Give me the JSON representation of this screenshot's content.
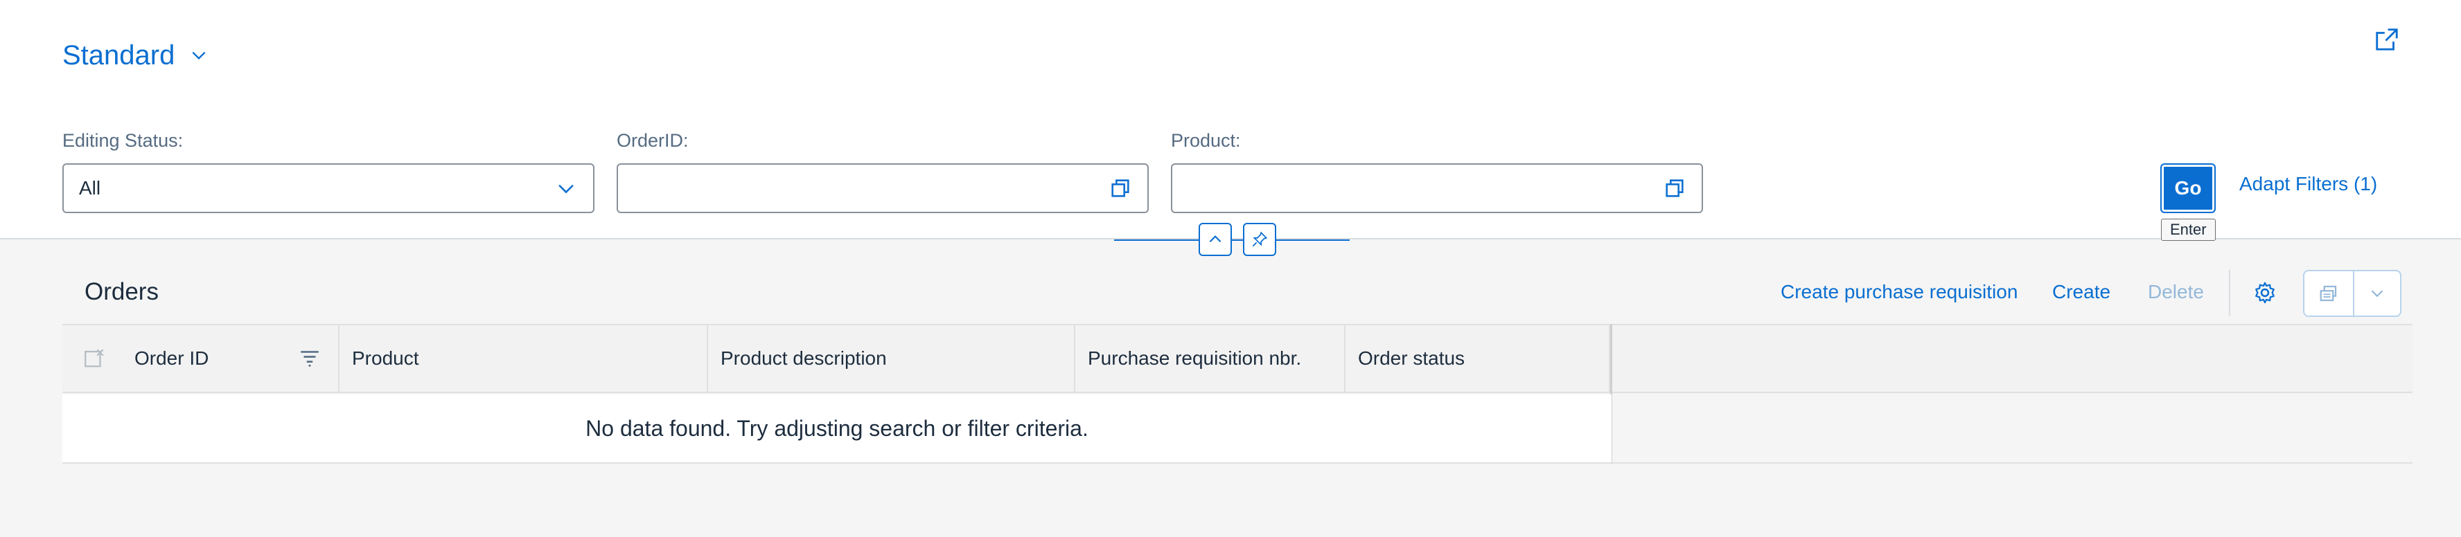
{
  "variant": {
    "title": "Standard"
  },
  "filters": {
    "editing_status": {
      "label": "Editing Status:",
      "value": "All"
    },
    "order_id": {
      "label": "OrderID:",
      "value": ""
    },
    "product": {
      "label": "Product:",
      "value": ""
    }
  },
  "actions": {
    "go_label": "Go",
    "go_tooltip": "Enter",
    "adapt_filters_label": "Adapt Filters (1)"
  },
  "table": {
    "title": "Orders",
    "toolbar": {
      "create_pr_label": "Create purchase requisition",
      "create_label": "Create",
      "delete_label": "Delete"
    },
    "columns": [
      "Order ID",
      "Product",
      "Product description",
      "Purchase requisition nbr.",
      "Order status"
    ],
    "empty_message": "No data found. Try adjusting search or filter criteria."
  },
  "colors": {
    "accent": "#0a6ed1",
    "disabled_link": "#94b8da",
    "background": "#f5f5f5",
    "header_bg": "#ffffff"
  },
  "icons": [
    "chevron-down-icon",
    "share-icon",
    "value-help-icon",
    "collapse-up-icon",
    "pin-icon",
    "settings-icon",
    "export-icon",
    "select-all-icon",
    "filter-icon"
  ]
}
